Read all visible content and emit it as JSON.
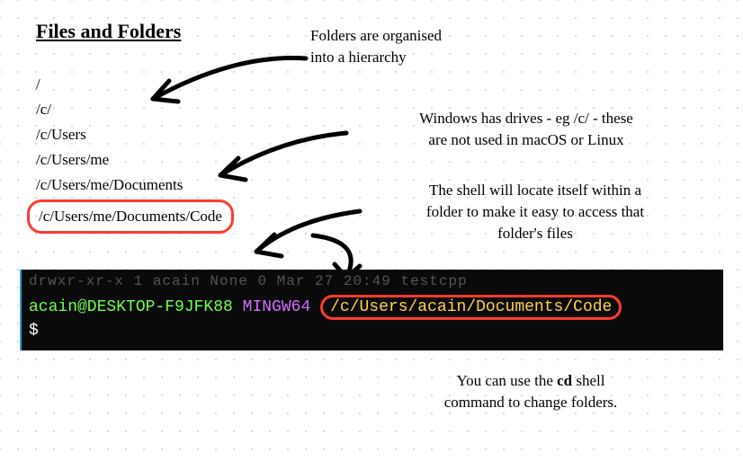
{
  "title": "Files and Folders",
  "folders": {
    "p0": "/",
    "p1": "/c/",
    "p2": "/c/Users",
    "p3": "/c/Users/me",
    "p4": "/c/Users/me/Documents",
    "p5": "/c/Users/me/Documents/Code"
  },
  "notes": {
    "hierarchy_l1": "Folders are organised",
    "hierarchy_l2": "into a hierarchy",
    "drives_l1": "Windows has drives - eg /c/ - these",
    "drives_l2": "are not used in macOS or Linux",
    "shell_l1": "The shell will locate itself within a",
    "shell_l2": "folder to make it easy to access that",
    "shell_l3": "folder's files",
    "cd_l1_pre": "You can use the ",
    "cd_l1_bold": "cd",
    "cd_l1_post": " shell",
    "cd_l2": "command to change folders."
  },
  "terminal": {
    "topline": "drwxr-xr-x 1 acain None 0 Mar 27 20:49 testcpp",
    "user": "acain@DESKTOP-F9JFK88",
    "mingw": "MINGW64",
    "path": "/c/Users/acain/Documents/Code",
    "prompt": "$"
  }
}
